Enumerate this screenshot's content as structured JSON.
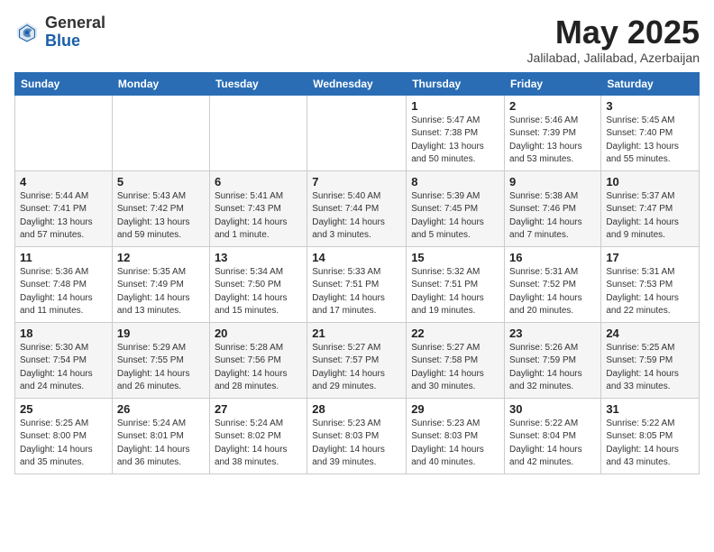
{
  "logo": {
    "general": "General",
    "blue": "Blue"
  },
  "title": "May 2025",
  "subtitle": "Jalilabad, Jalilabad, Azerbaijan",
  "days_header": [
    "Sunday",
    "Monday",
    "Tuesday",
    "Wednesday",
    "Thursday",
    "Friday",
    "Saturday"
  ],
  "weeks": [
    [
      {
        "day": "",
        "info": ""
      },
      {
        "day": "",
        "info": ""
      },
      {
        "day": "",
        "info": ""
      },
      {
        "day": "",
        "info": ""
      },
      {
        "day": "1",
        "info": "Sunrise: 5:47 AM\nSunset: 7:38 PM\nDaylight: 13 hours\nand 50 minutes."
      },
      {
        "day": "2",
        "info": "Sunrise: 5:46 AM\nSunset: 7:39 PM\nDaylight: 13 hours\nand 53 minutes."
      },
      {
        "day": "3",
        "info": "Sunrise: 5:45 AM\nSunset: 7:40 PM\nDaylight: 13 hours\nand 55 minutes."
      }
    ],
    [
      {
        "day": "4",
        "info": "Sunrise: 5:44 AM\nSunset: 7:41 PM\nDaylight: 13 hours\nand 57 minutes."
      },
      {
        "day": "5",
        "info": "Sunrise: 5:43 AM\nSunset: 7:42 PM\nDaylight: 13 hours\nand 59 minutes."
      },
      {
        "day": "6",
        "info": "Sunrise: 5:41 AM\nSunset: 7:43 PM\nDaylight: 14 hours\nand 1 minute."
      },
      {
        "day": "7",
        "info": "Sunrise: 5:40 AM\nSunset: 7:44 PM\nDaylight: 14 hours\nand 3 minutes."
      },
      {
        "day": "8",
        "info": "Sunrise: 5:39 AM\nSunset: 7:45 PM\nDaylight: 14 hours\nand 5 minutes."
      },
      {
        "day": "9",
        "info": "Sunrise: 5:38 AM\nSunset: 7:46 PM\nDaylight: 14 hours\nand 7 minutes."
      },
      {
        "day": "10",
        "info": "Sunrise: 5:37 AM\nSunset: 7:47 PM\nDaylight: 14 hours\nand 9 minutes."
      }
    ],
    [
      {
        "day": "11",
        "info": "Sunrise: 5:36 AM\nSunset: 7:48 PM\nDaylight: 14 hours\nand 11 minutes."
      },
      {
        "day": "12",
        "info": "Sunrise: 5:35 AM\nSunset: 7:49 PM\nDaylight: 14 hours\nand 13 minutes."
      },
      {
        "day": "13",
        "info": "Sunrise: 5:34 AM\nSunset: 7:50 PM\nDaylight: 14 hours\nand 15 minutes."
      },
      {
        "day": "14",
        "info": "Sunrise: 5:33 AM\nSunset: 7:51 PM\nDaylight: 14 hours\nand 17 minutes."
      },
      {
        "day": "15",
        "info": "Sunrise: 5:32 AM\nSunset: 7:51 PM\nDaylight: 14 hours\nand 19 minutes."
      },
      {
        "day": "16",
        "info": "Sunrise: 5:31 AM\nSunset: 7:52 PM\nDaylight: 14 hours\nand 20 minutes."
      },
      {
        "day": "17",
        "info": "Sunrise: 5:31 AM\nSunset: 7:53 PM\nDaylight: 14 hours\nand 22 minutes."
      }
    ],
    [
      {
        "day": "18",
        "info": "Sunrise: 5:30 AM\nSunset: 7:54 PM\nDaylight: 14 hours\nand 24 minutes."
      },
      {
        "day": "19",
        "info": "Sunrise: 5:29 AM\nSunset: 7:55 PM\nDaylight: 14 hours\nand 26 minutes."
      },
      {
        "day": "20",
        "info": "Sunrise: 5:28 AM\nSunset: 7:56 PM\nDaylight: 14 hours\nand 28 minutes."
      },
      {
        "day": "21",
        "info": "Sunrise: 5:27 AM\nSunset: 7:57 PM\nDaylight: 14 hours\nand 29 minutes."
      },
      {
        "day": "22",
        "info": "Sunrise: 5:27 AM\nSunset: 7:58 PM\nDaylight: 14 hours\nand 30 minutes."
      },
      {
        "day": "23",
        "info": "Sunrise: 5:26 AM\nSunset: 7:59 PM\nDaylight: 14 hours\nand 32 minutes."
      },
      {
        "day": "24",
        "info": "Sunrise: 5:25 AM\nSunset: 7:59 PM\nDaylight: 14 hours\nand 33 minutes."
      }
    ],
    [
      {
        "day": "25",
        "info": "Sunrise: 5:25 AM\nSunset: 8:00 PM\nDaylight: 14 hours\nand 35 minutes."
      },
      {
        "day": "26",
        "info": "Sunrise: 5:24 AM\nSunset: 8:01 PM\nDaylight: 14 hours\nand 36 minutes."
      },
      {
        "day": "27",
        "info": "Sunrise: 5:24 AM\nSunset: 8:02 PM\nDaylight: 14 hours\nand 38 minutes."
      },
      {
        "day": "28",
        "info": "Sunrise: 5:23 AM\nSunset: 8:03 PM\nDaylight: 14 hours\nand 39 minutes."
      },
      {
        "day": "29",
        "info": "Sunrise: 5:23 AM\nSunset: 8:03 PM\nDaylight: 14 hours\nand 40 minutes."
      },
      {
        "day": "30",
        "info": "Sunrise: 5:22 AM\nSunset: 8:04 PM\nDaylight: 14 hours\nand 42 minutes."
      },
      {
        "day": "31",
        "info": "Sunrise: 5:22 AM\nSunset: 8:05 PM\nDaylight: 14 hours\nand 43 minutes."
      }
    ]
  ]
}
